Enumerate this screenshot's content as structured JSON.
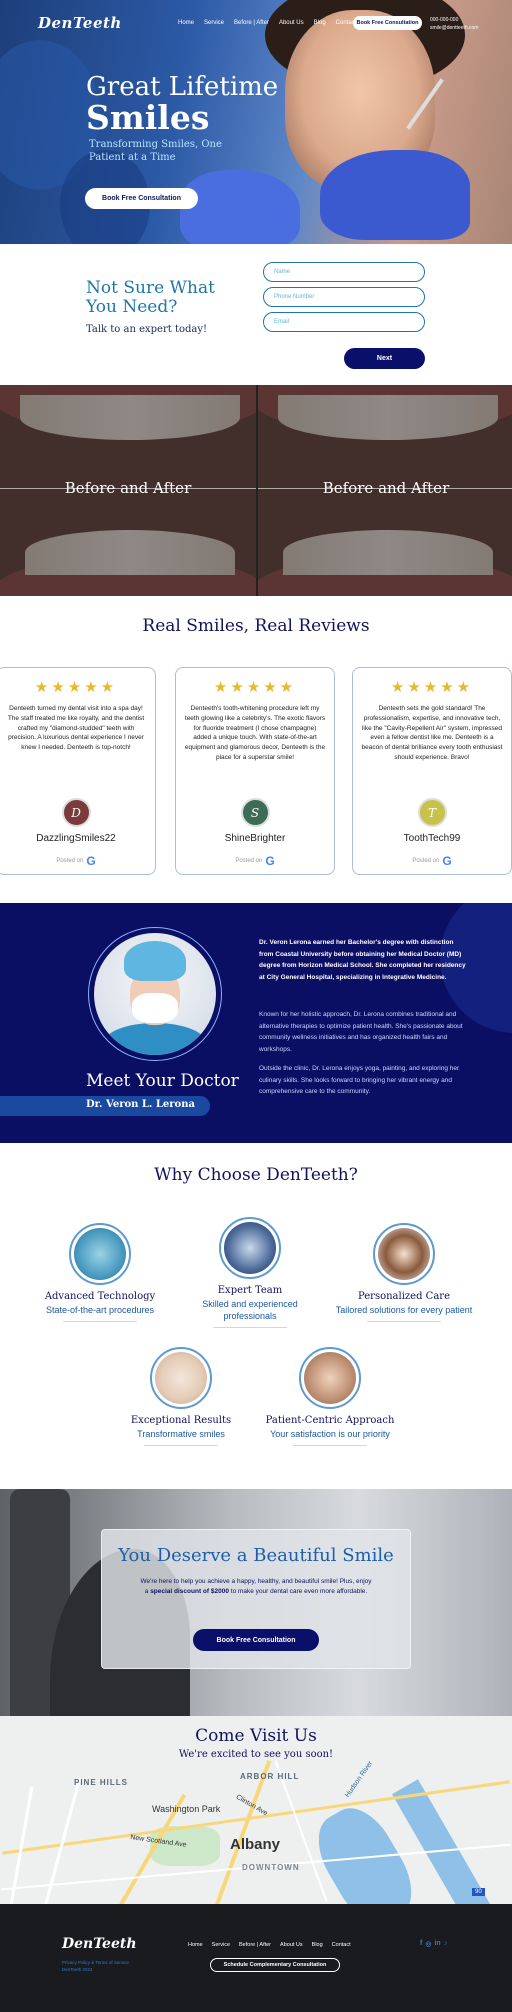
{
  "nav": {
    "logo": "DenTeeth",
    "links": [
      "Home",
      "Service",
      "Before | After",
      "About Us",
      "Blog",
      "Contact"
    ],
    "cta": "Book Free Consultation",
    "phone": "000-000-000",
    "email": "smile@dentteeth.com"
  },
  "hero": {
    "title_line1": "Great Lifetime",
    "title_line2": "Smiles",
    "tagline": "Transforming Smiles, One Patient at a Time",
    "cta": "Book Free Consultation"
  },
  "contact_form": {
    "heading": "Not Sure What You Need?",
    "subheading": "Talk to an expert today!",
    "name_placeholder": "Name",
    "phone_placeholder": "Phone Number",
    "email_placeholder": "Email",
    "submit": "Next"
  },
  "before_after": {
    "labels": [
      "Before and After",
      "Before and After"
    ]
  },
  "reviews": {
    "heading": "Real Smiles, Real Reviews",
    "posted_on": "Posted on",
    "items": [
      {
        "stars": "★★★★★",
        "text": "Denteeth turned my dental visit into a spa day! The staff treated me like royalty, and the dentist crafted my \"diamond-studded\" teeth with precision. A luxurious dental experience I never knew I needed. Denteeth is top-notch!",
        "initial": "D",
        "name": "DazzlingSmiles22",
        "avatar_color": "#7b3b3b"
      },
      {
        "stars": "★★★★★",
        "text": "Denteeth's tooth-whitening procedure left my teeth glowing like a celebrity's. The exotic flavors for fluoride treatment (I chose champagne) added a unique touch. With state-of-the-art equipment and glamorous decor, Denteeth is the place for a superstar smile!",
        "initial": "S",
        "name": "ShineBrighter",
        "avatar_color": "#3d6b55"
      },
      {
        "stars": "★★★★★",
        "text": "Denteeth sets the gold standard! The professionalism, expertise, and innovative tech, like the \"Cavity-Repellent Air\" system, impressed even a fellow dentist like me. Denteeth is a beacon of dental brilliance every tooth enthusiast should experience. Bravo!",
        "initial": "T",
        "name": "ToothTech99",
        "avatar_color": "#c9c24a"
      }
    ]
  },
  "doctor": {
    "heading": "Meet Your Doctor",
    "name": "Dr. Veron L. Lerona",
    "bio1": "Dr. Veron Lerona earned her Bachelor's degree with distinction from Coastal University  before obtaining her Medical Doctor (MD) degree from Horizon Medical School.  She  completed her residency at City General Hospital, specializing in Integrative Medicine.",
    "bio2": "Known for her holistic approach, Dr. Lerona combines traditional and alternative therapies  to optimize patient health. She's passionate about community wellness initiatives and has  organized health fairs and workshops.",
    "bio3": "Outside the clinic, Dr. Lerona enjoys yoga, painting, and exploring her culinary skills. She looks forward to bringing her vibrant energy and comprehensive care to the community."
  },
  "why": {
    "heading": "Why Choose DenTeeth?",
    "features": [
      {
        "title": "Advanced Technology",
        "subtitle": "State-of-the-art procedures",
        "icon": "technology-photo"
      },
      {
        "title": "Expert Team",
        "subtitle": "Skilled and experienced professionals",
        "icon": "team-photo"
      },
      {
        "title": "Personalized Care",
        "subtitle": "Tailored solutions for every patient",
        "icon": "care-photo"
      },
      {
        "title": "Exceptional Results",
        "subtitle": "Transformative smiles",
        "icon": "results-photo"
      },
      {
        "title": "Patient-Centric Approach",
        "subtitle": "Your satisfaction is our priority",
        "icon": "patient-photo"
      }
    ]
  },
  "deserve": {
    "heading": "You Deserve a Beautiful Smile",
    "text_before": "We're here to help you achieve a happy, healthy, and beautiful smile! Plus, enjoy a ",
    "discount": "special discount of $2000",
    "text_after": " to make your dental care even more affordable.",
    "cta": "Book Free Consultation"
  },
  "visit": {
    "heading": "Come Visit Us",
    "subheading": "We're excited to see you soon!",
    "map_labels": {
      "pine_hills": "PINE HILLS",
      "arbor_hill": "ARBOR HILL",
      "washington_park": "Washington Park",
      "clinton_ave": "Clinton Ave",
      "city": "Albany",
      "downtown": "DOWNTOWN",
      "hudson": "Hudson River",
      "new_scotland": "New Scotland Ave",
      "highway": "90"
    }
  },
  "footer": {
    "logo": "DenTeeth",
    "policy": "Privacy Policy & Terms of Service",
    "copyright": "DenTeeth 2024",
    "links": [
      "Home",
      "Service",
      "Before | After",
      "About Us",
      "Blog",
      "Contact"
    ],
    "cta": "Schedule Complementary Consultation",
    "social": [
      "f",
      "◎",
      "in",
      "♪"
    ]
  },
  "colors": {
    "navy": "#0a0f64",
    "accent_blue": "#1e76a8",
    "star_gold": "#e8b92a"
  }
}
